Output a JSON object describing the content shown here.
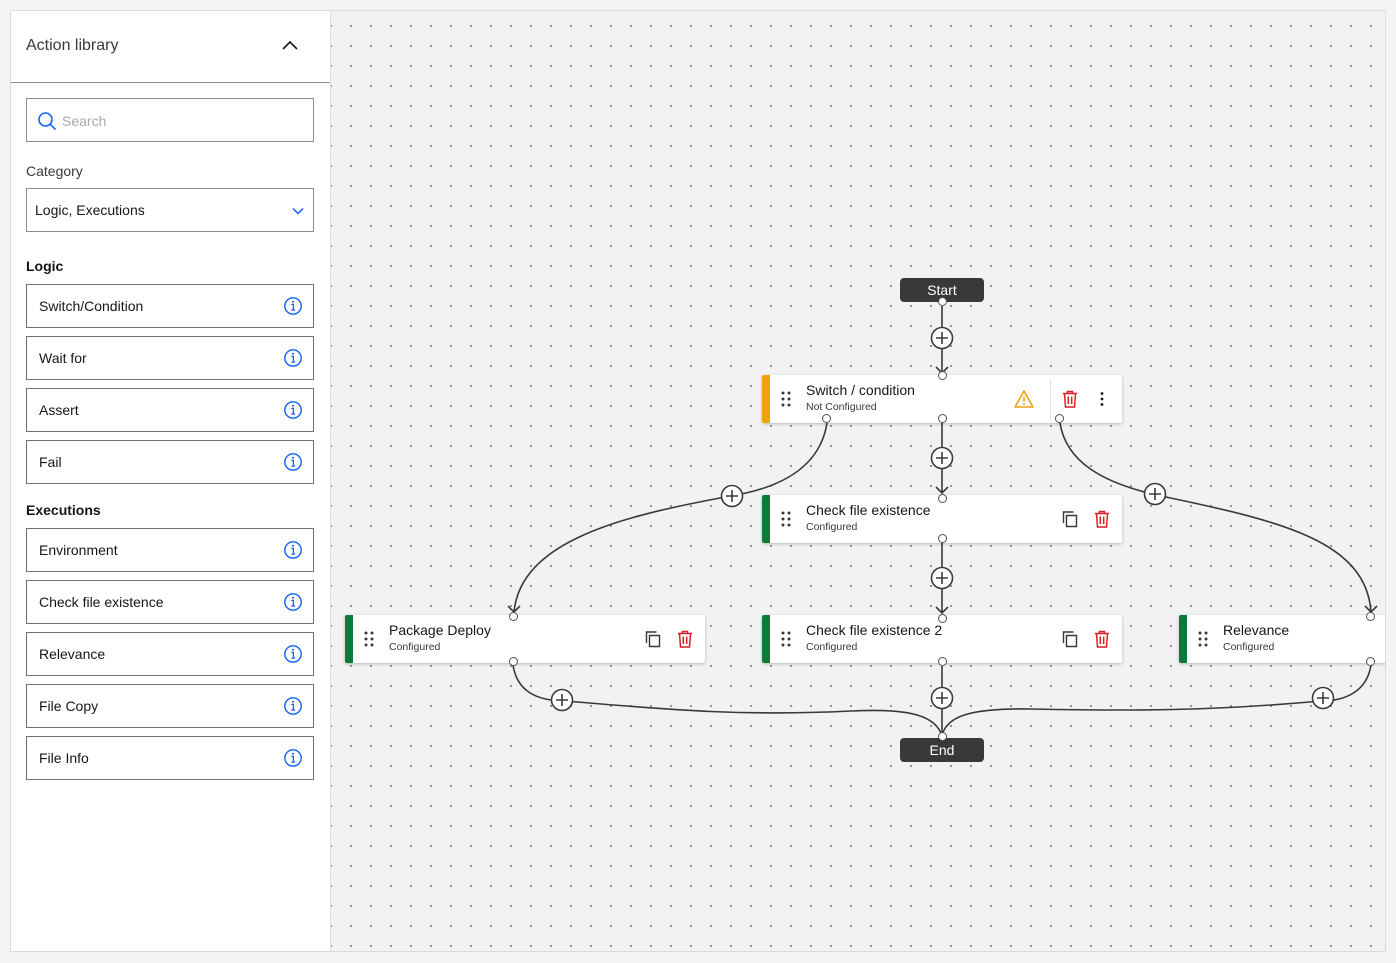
{
  "sidebar": {
    "title": "Action library",
    "search": {
      "placeholder": "Search",
      "value": ""
    },
    "category": {
      "label": "Category",
      "value": "Logic, Executions"
    },
    "groups": [
      {
        "heading": "Logic",
        "items": [
          "Switch/Condition",
          "Wait for",
          "Assert",
          "Fail"
        ]
      },
      {
        "heading": "Executions",
        "items": [
          "Environment",
          "Check file existence",
          "Relevance",
          "File Copy",
          "File Info"
        ]
      }
    ]
  },
  "canvas": {
    "start_label": "Start",
    "end_label": "End",
    "nodes": {
      "switch": {
        "title": "Switch / condition",
        "status": "Not Configured",
        "status_color": "#f1a20c",
        "warning_icon": "warning-icon"
      },
      "check1": {
        "title": "Check file existence",
        "status": "Configured",
        "status_color": "#0b7a3a"
      },
      "deploy": {
        "title": "Package Deploy",
        "status": "Configured",
        "status_color": "#0b7a3a"
      },
      "check2": {
        "title": "Check file existence 2",
        "status": "Configured",
        "status_color": "#0b7a3a"
      },
      "relevance": {
        "title": "Relevance",
        "status": "Configured",
        "status_color": "#0b7a3a"
      }
    }
  },
  "colors": {
    "accent_info": "#0f62fe",
    "delete": "#da1e28",
    "warning": "#f1a20c",
    "terminal": "#393939"
  }
}
